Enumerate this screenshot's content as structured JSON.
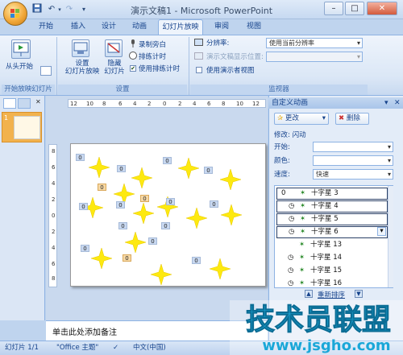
{
  "titlebar": {
    "title": "演示文稿1 - Microsoft PowerPoint"
  },
  "quick_access": [
    "save-icon",
    "undo-icon",
    "redo-icon",
    "customize-icon"
  ],
  "tabs": [
    "开始",
    "插入",
    "设计",
    "动画",
    "幻灯片放映",
    "审阅",
    "视图"
  ],
  "active_tab": "幻灯片放映",
  "ribbon": {
    "group1": {
      "from_start": "从头开始",
      "label": "开始放映幻灯片"
    },
    "group2": {
      "setup_show": "设置\n幻灯片放映",
      "hide_slide": "隐藏\n幻灯片",
      "record_narration": "录制旁白",
      "rehearse_timings": "排练计时",
      "use_rehearsed": "使用排练计时",
      "label": "设置"
    },
    "group3": {
      "resolution_label": "分辨率:",
      "resolution_value": "使用当前分辨率",
      "show_on_label": "演示文稿显示位置:",
      "presenter_view": "使用演示者视图",
      "label": "监视器"
    }
  },
  "thumb_pane": {
    "slide_number": "1"
  },
  "ruler": {
    "horizontal": [
      "12",
      "10",
      "8",
      "6",
      "4",
      "2",
      "0",
      "2",
      "4",
      "6",
      "8",
      "10",
      "12"
    ],
    "vertical": [
      "8",
      "6",
      "4",
      "2",
      "0",
      "2",
      "4",
      "6",
      "8"
    ]
  },
  "slide": {
    "tags": [
      "0",
      "0",
      "0",
      "0",
      "0",
      "0",
      "0",
      "0",
      "0",
      "0",
      "0",
      "0",
      "0",
      "0",
      "0",
      "0"
    ]
  },
  "notes": {
    "placeholder": "单击此处添加备注"
  },
  "taskpane": {
    "title": "自定义动画",
    "change_btn": "更改",
    "delete_btn": "删除",
    "modify_label": "修改: 闪动",
    "start_label": "开始:",
    "color_label": "颜色:",
    "speed_label": "速度:",
    "speed_value": "快速",
    "list_items": [
      {
        "num": "0",
        "name": "十字星 3"
      },
      {
        "num": "",
        "name": "十字星 4"
      },
      {
        "num": "",
        "name": "十字星 5"
      },
      {
        "num": "",
        "name": "十字星 6"
      },
      {
        "num": "",
        "name": "十字星 13"
      },
      {
        "num": "",
        "name": "十字星 14"
      },
      {
        "num": "",
        "name": "十字星 15"
      },
      {
        "num": "",
        "name": "十字星 16"
      }
    ],
    "reorder_label": "重新排序"
  },
  "status": {
    "slide_info": "幻灯片 1/1",
    "theme": "\"Office 主题\"",
    "language": "中文(中国)"
  },
  "watermark": {
    "main": "技术员联盟",
    "url": "www.jsgho.com"
  },
  "colors": {
    "accent": "#15428b",
    "star": "#fde910",
    "ribbon": "#dbe7f6"
  }
}
